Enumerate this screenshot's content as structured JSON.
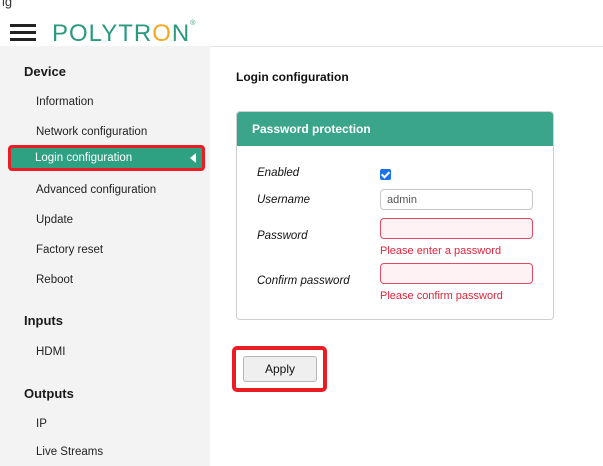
{
  "header": {
    "crop_text": "lg",
    "menu_icon": "hamburger-icon",
    "logo_start": "POLYTR",
    "logo_o": "O",
    "logo_end": "N",
    "logo_tm": "®"
  },
  "sidebar": {
    "device_title": "Device",
    "device_items": [
      "Information",
      "Network configuration",
      "Login configuration",
      "Advanced configuration",
      "Update",
      "Factory reset",
      "Reboot"
    ],
    "inputs_title": "Inputs",
    "inputs_items": [
      "HDMI"
    ],
    "outputs_title": "Outputs",
    "outputs_items": [
      "IP",
      "Live Streams"
    ],
    "active_item": "Login configuration",
    "accent_color": "#2fa183",
    "highlight_color": "#ea1c24"
  },
  "main": {
    "page_title": "Login configuration",
    "panel_title": "Password protection",
    "enabled_label": "Enabled",
    "enabled_checked": true,
    "username_label": "Username",
    "username_value": "admin",
    "password_label": "Password",
    "password_value": "",
    "password_error": "Please enter a password",
    "confirm_label": "Confirm password",
    "confirm_value": "",
    "confirm_error": "Please confirm password",
    "apply_label": "Apply",
    "error_color": "#e0233b"
  }
}
